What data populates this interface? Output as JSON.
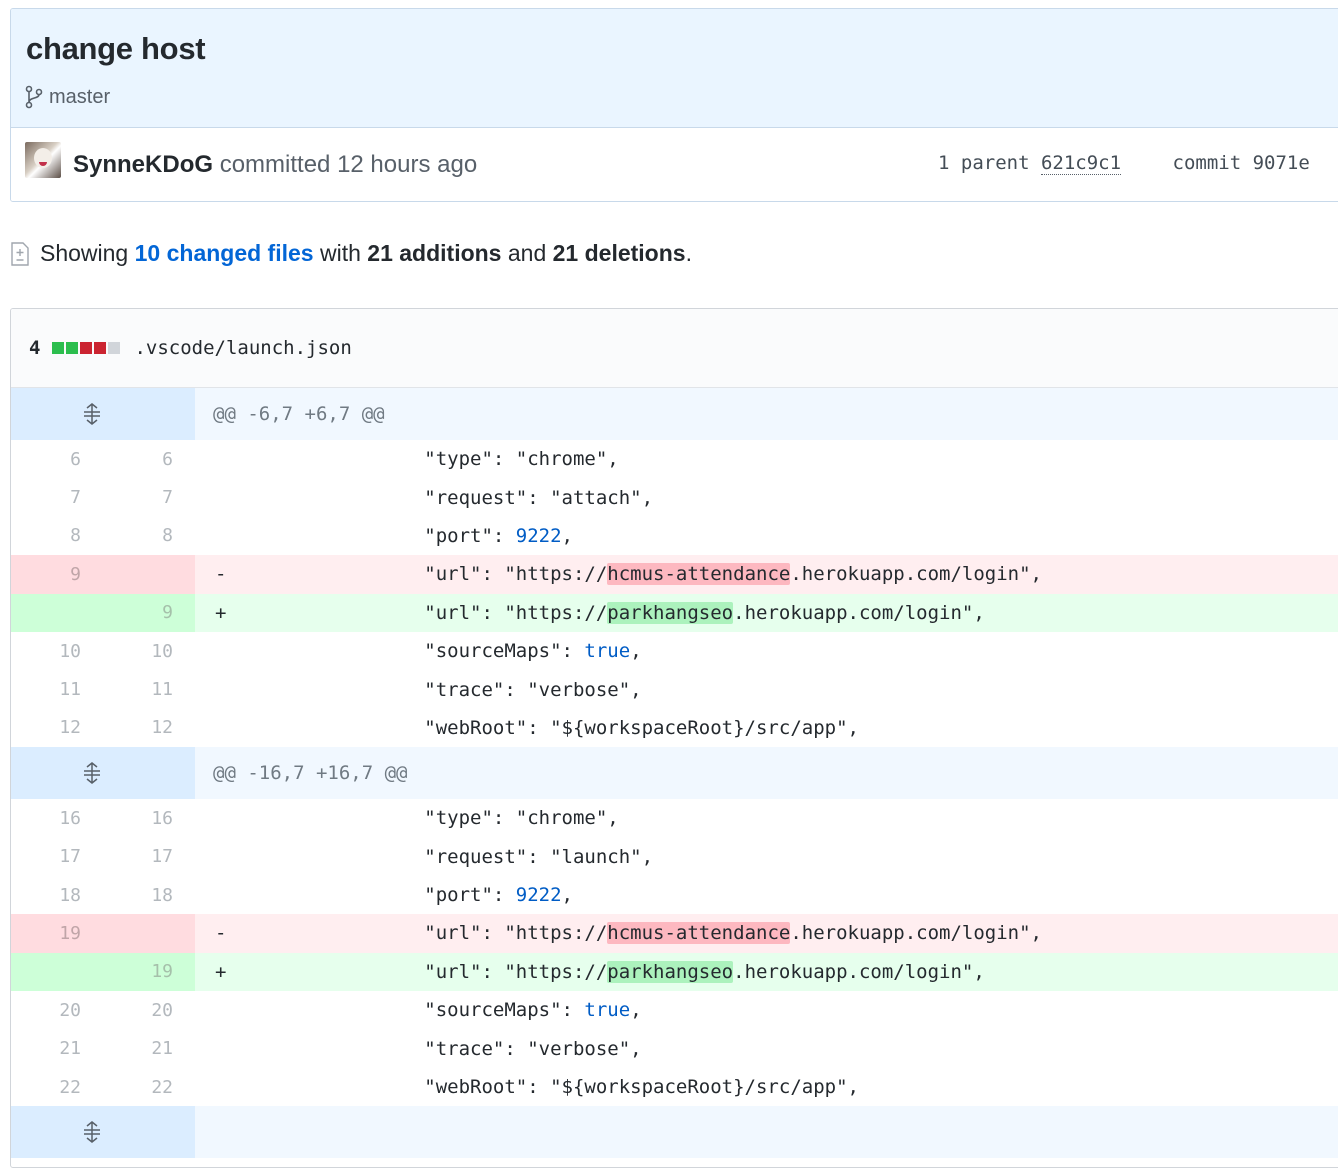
{
  "commit": {
    "title": "change host",
    "branch": "master",
    "author": "SynneKDoG",
    "action": "committed",
    "time": "12 hours ago",
    "parent_label": "1 parent",
    "parent_sha": "621c9c1",
    "commit_label": "commit",
    "commit_sha": "9071e"
  },
  "toc": {
    "prefix": "Showing",
    "changed_files": "10 changed files",
    "with": "with",
    "additions": "21 additions",
    "and": "and",
    "deletions": "21 deletions",
    "suffix": "."
  },
  "file": {
    "count": "4",
    "path": ".vscode/launch.json",
    "diffstat_blocks": [
      "add",
      "add",
      "del",
      "del",
      "neu"
    ]
  },
  "hunks": [
    {
      "header": "@@ -6,7 +6,7 @@",
      "lines": [
        {
          "type": "ctx",
          "old": "6",
          "new": "6",
          "pre": "            \"type\": \"chrome\","
        },
        {
          "type": "ctx",
          "old": "7",
          "new": "7",
          "pre": "            \"request\": \"attach\","
        },
        {
          "type": "ctx",
          "old": "8",
          "new": "8",
          "pre": "            \"port\": ",
          "num": "9222",
          "post": ","
        },
        {
          "type": "del",
          "old": "9",
          "new": "",
          "sign": "-",
          "pre": "            \"url\": \"https://",
          "hl": "hcmus-attendance",
          "post": ".herokuapp.com/login\","
        },
        {
          "type": "add",
          "old": "",
          "new": "9",
          "sign": "+",
          "pre": "            \"url\": \"https://",
          "hl": "parkhangseo",
          "post": ".herokuapp.com/login\","
        },
        {
          "type": "ctx",
          "old": "10",
          "new": "10",
          "pre": "            \"sourceMaps\": ",
          "kw": "true",
          "post": ","
        },
        {
          "type": "ctx",
          "old": "11",
          "new": "11",
          "pre": "            \"trace\": \"verbose\","
        },
        {
          "type": "ctx",
          "old": "12",
          "new": "12",
          "pre": "            \"webRoot\": \"${workspaceRoot}/src/app\","
        }
      ]
    },
    {
      "header": "@@ -16,7 +16,7 @@",
      "lines": [
        {
          "type": "ctx",
          "old": "16",
          "new": "16",
          "pre": "            \"type\": \"chrome\","
        },
        {
          "type": "ctx",
          "old": "17",
          "new": "17",
          "pre": "            \"request\": \"launch\","
        },
        {
          "type": "ctx",
          "old": "18",
          "new": "18",
          "pre": "            \"port\": ",
          "num": "9222",
          "post": ","
        },
        {
          "type": "del",
          "old": "19",
          "new": "",
          "sign": "-",
          "pre": "            \"url\": \"https://",
          "hl": "hcmus-attendance",
          "post": ".herokuapp.com/login\","
        },
        {
          "type": "add",
          "old": "",
          "new": "19",
          "sign": "+",
          "pre": "            \"url\": \"https://",
          "hl": "parkhangseo",
          "post": ".herokuapp.com/login\","
        },
        {
          "type": "ctx",
          "old": "20",
          "new": "20",
          "pre": "            \"sourceMaps\": ",
          "kw": "true",
          "post": ","
        },
        {
          "type": "ctx",
          "old": "21",
          "new": "21",
          "pre": "            \"trace\": \"verbose\","
        },
        {
          "type": "ctx",
          "old": "22",
          "new": "22",
          "pre": "            \"webRoot\": \"${workspaceRoot}/src/app\","
        }
      ]
    },
    {
      "header": "",
      "lines": []
    }
  ],
  "colors": {
    "hunk_bg": "#f1f8ff",
    "del_bg": "#ffeef0",
    "add_bg": "#e6ffed",
    "link": "#0366d6"
  },
  "icons": {
    "branch": "git-branch-icon",
    "diff": "diff-icon",
    "expand": "unfold-icon"
  }
}
